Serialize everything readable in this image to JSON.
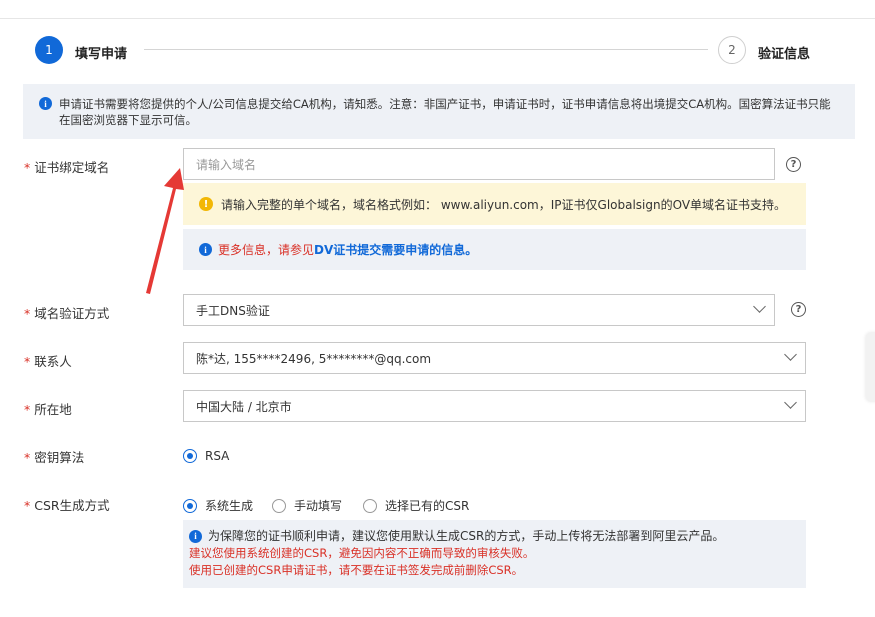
{
  "steps": [
    {
      "number": "1",
      "label": "填写申请"
    },
    {
      "number": "2",
      "label": "验证信息"
    }
  ],
  "notice": "申请证书需要将您提供的个人/公司信息提交给CA机构，请知悉。注意：非国产证书，申请证书时，证书申请信息将出境提交CA机构。国密算法证书只能在国密浏览器下显示可信。",
  "fields": {
    "domain": {
      "label": "证书绑定域名",
      "placeholder": "请输入域名",
      "help": "?"
    },
    "domain_warning": "请输入完整的单个域名，域名格式例如： www.aliyun.com，IP证书仅Globalsign的OV单域名证书支持。",
    "domain_more_prefix": "更多信息，请参见",
    "domain_more_link": "DV证书提交需要申请的信息。",
    "verify_method": {
      "label": "域名验证方式",
      "value": "手工DNS验证",
      "help": "?"
    },
    "contact": {
      "label": "联系人",
      "value": "陈*达, 155****2496, 5********@qq.com"
    },
    "location": {
      "label": "所在地",
      "value": "中国大陆 / 北京市"
    },
    "key_algo": {
      "label": "密钥算法",
      "options": [
        "RSA"
      ],
      "selected": "RSA"
    },
    "csr": {
      "label": "CSR生成方式",
      "options": [
        "系统生成",
        "手动填写",
        "选择已有的CSR"
      ],
      "selected": "系统生成",
      "info": "为保障您的证书顺利申请，建议您使用默认生成CSR的方式，手动上传将无法部署到阿里云产品。",
      "warning1": "建议您使用系统创建的CSR，避免因内容不正确而导致的审核失败。",
      "warning2": "使用已创建的CSR申请证书，请不要在证书签发完成前删除CSR。"
    }
  },
  "colors": {
    "accent": "#1169d8",
    "error": "#d93026",
    "warning": "#f2b705",
    "annotation_arrow": "#e53935"
  },
  "icons": [
    "info-icon",
    "help-icon",
    "warning-icon",
    "chevron-down-icon",
    "annotation-arrow"
  ]
}
